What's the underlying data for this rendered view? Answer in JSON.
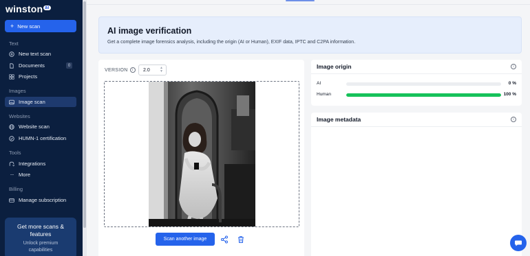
{
  "app": {
    "brand": "winston",
    "brand_badge": "ai"
  },
  "sidebar": {
    "new_scan_label": "New scan",
    "sections": [
      {
        "title": "Text",
        "items": [
          {
            "label": "New text scan",
            "icon": "plus-circle-icon"
          },
          {
            "label": "Documents",
            "icon": "document-icon",
            "badge": "0"
          },
          {
            "label": "Projects",
            "icon": "grid-icon"
          }
        ]
      },
      {
        "title": "Images",
        "items": [
          {
            "label": "Image scan",
            "icon": "image-icon",
            "active": true
          }
        ]
      },
      {
        "title": "Websites",
        "items": [
          {
            "label": "Website scan",
            "icon": "globe-icon"
          },
          {
            "label": "HUMN-1 certification",
            "icon": "check-circle-icon"
          }
        ]
      },
      {
        "title": "Tools",
        "items": [
          {
            "label": "Integrations",
            "icon": "integrations-icon"
          },
          {
            "label": "More",
            "icon": "more-icon"
          }
        ]
      },
      {
        "title": "Billing",
        "items": [
          {
            "label": "Manage subscription",
            "icon": "credit-card-icon"
          }
        ]
      }
    ],
    "promo": {
      "title": "Get more scans & features",
      "subtitle": "Unlock premium capabilities"
    }
  },
  "header": {
    "title": "AI image verification",
    "subtitle": "Get a complete image forensics analysis, including the origin (AI or Human), EXIF data, IPTC and C2PA information."
  },
  "scan_panel": {
    "version_label": "VERSION",
    "version_value": "2.0",
    "scan_button_label": "Scan another image"
  },
  "image_origin": {
    "title": "Image origin",
    "rows": [
      {
        "label": "AI",
        "percent_text": "0 %",
        "fraction": 0.0
      },
      {
        "label": "Human",
        "percent_text": "100 %",
        "fraction": 1.0
      }
    ],
    "bar_color": "#16c25a"
  },
  "image_metadata": {
    "title": "Image metadata"
  },
  "colors": {
    "sidebar_bg": "#0b1f3f",
    "accent": "#2563eb",
    "header_bg": "#e6eefc"
  }
}
